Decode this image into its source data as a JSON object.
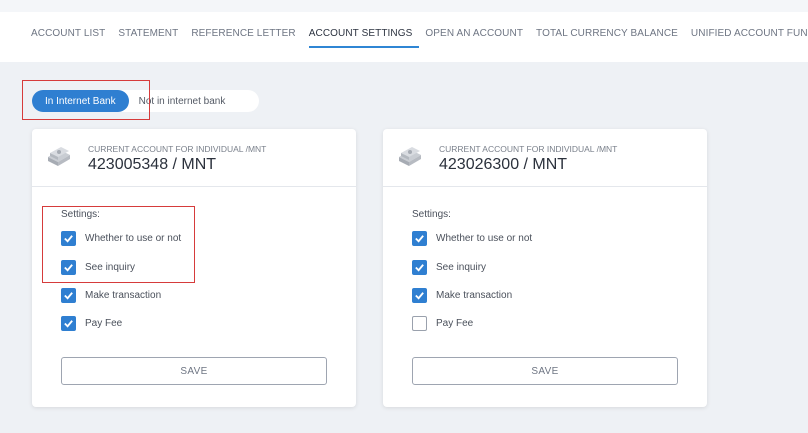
{
  "nav": {
    "tabs": [
      {
        "label": "ACCOUNT LIST"
      },
      {
        "label": "STATEMENT"
      },
      {
        "label": "REFERENCE LETTER"
      },
      {
        "label": "ACCOUNT SETTINGS"
      },
      {
        "label": "OPEN AN ACCOUNT"
      },
      {
        "label": "TOTAL CURRENCY BALANCE"
      },
      {
        "label": "UNIFIED ACCOUNT FUND"
      }
    ],
    "active_tab": "ACCOUNT SETTINGS"
  },
  "toggle": {
    "on_label": "In Internet Bank",
    "off_label": "Not in internet bank"
  },
  "colors": {
    "accent": "#2f7fd1",
    "highlight_box": "#d63b3b"
  },
  "cards": [
    {
      "type": "CURRENT ACCOUNT FOR INDIVIDUAL /MNT",
      "number": "423005348 / MNT",
      "settings_label": "Settings:",
      "options": [
        {
          "label": "Whether to use or not",
          "checked": true
        },
        {
          "label": "See inquiry",
          "checked": true
        },
        {
          "label": "Make transaction",
          "checked": true
        },
        {
          "label": "Pay Fee",
          "checked": true
        }
      ],
      "save_label": "SAVE"
    },
    {
      "type": "CURRENT ACCOUNT FOR INDIVIDUAL /MNT",
      "number": "423026300 / MNT",
      "settings_label": "Settings:",
      "options": [
        {
          "label": "Whether to use or not",
          "checked": true
        },
        {
          "label": "See inquiry",
          "checked": true
        },
        {
          "label": "Make transaction",
          "checked": true
        },
        {
          "label": "Pay Fee",
          "checked": false
        }
      ],
      "save_label": "SAVE"
    }
  ]
}
